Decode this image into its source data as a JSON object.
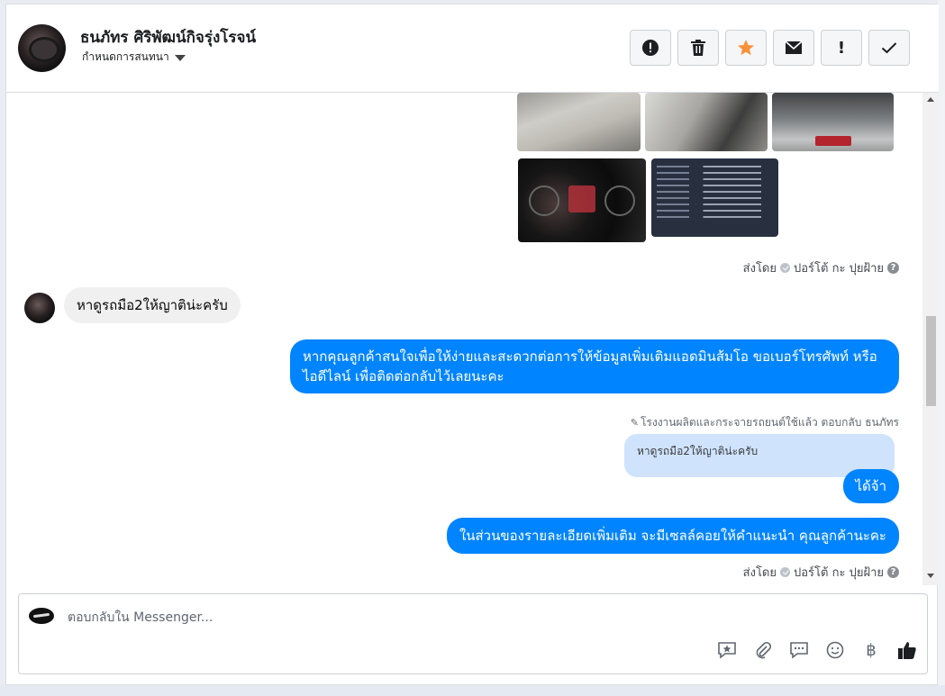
{
  "header": {
    "name": "ธนภัทร ศิริพัฒน์กิจรุ่งโรจน์",
    "subtitle": "กำหนดการสนทนา",
    "actions": [
      {
        "icon": "alert-circle-icon"
      },
      {
        "icon": "trash-icon"
      },
      {
        "icon": "star-icon"
      },
      {
        "icon": "envelope-icon"
      },
      {
        "icon": "exclamation-icon",
        "text": "!"
      },
      {
        "icon": "check-icon"
      }
    ],
    "star_color": "#f7923b"
  },
  "messages": {
    "sent_by_1": {
      "prefix": "ส่งโดย",
      "sender": "ปอร์โต้ กะ ปุยฝ้าย",
      "help": "?"
    },
    "incoming_1": "หาดูรถมือ2ให้ญาติน่ะครับ",
    "outgoing_1": "หากคุณลูกค้าสนใจเพื่อให้ง่ายและสะดวกต่อการให้ข้อมูลเพิ่มเติมแอดมินส้มโอ ขอเบอร์โทรศัพท์ หรือ ไอดีไลน์ เพื่อติดต่อกลับไว้เลยนะคะ",
    "reply_note": "โรงงานผลิตและกระจายรถยนต์ใช้แล้ว ตอบกลับ ธนภัทร",
    "quoted": "หาดูรถมือ2ให้ญาติน่ะครับ",
    "outgoing_2": "ได้จ้า",
    "outgoing_3": "ในส่วนของรายละเอียดเพิ่มเติม จะมีเซลล์คอยให้คำแนะนำ คุณลูกค้านะคะ",
    "sent_by_2": {
      "prefix": "ส่งโดย",
      "sender": "ปอร์โต้ กะ ปุยฝ้าย",
      "help": "?"
    },
    "bubble_color": "#0084ff"
  },
  "composer": {
    "placeholder": "ตอบกลับใน Messenger...",
    "tools": [
      {
        "icon": "star-bubble-icon"
      },
      {
        "icon": "paperclip-icon"
      },
      {
        "icon": "chat-icon"
      },
      {
        "icon": "smiley-icon"
      },
      {
        "icon": "baht-icon",
        "text": "฿"
      },
      {
        "icon": "thumbs-up-icon"
      }
    ]
  }
}
